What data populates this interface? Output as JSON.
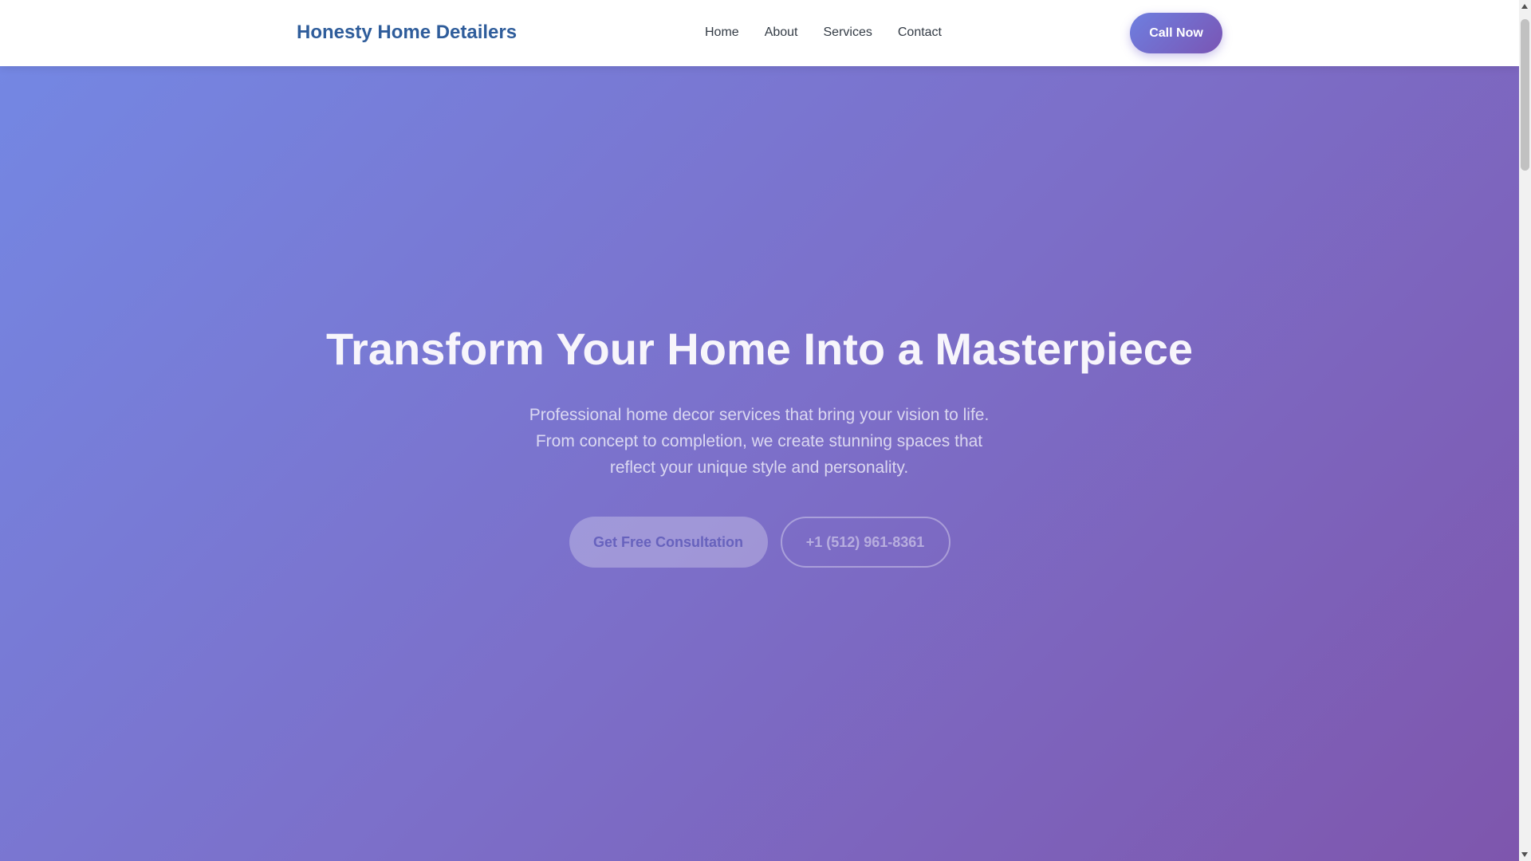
{
  "header": {
    "brand": "Honesty Home Detailers",
    "nav": [
      "Home",
      "About",
      "Services",
      "Contact"
    ],
    "call_button": "Call Now"
  },
  "hero": {
    "title": "Transform Your Home Into a Masterpiece",
    "subtitle": "Professional home decor services that bring your vision to life. From concept to completion, we create stunning spaces that reflect your unique style and personality.",
    "primary_button": "Get Free Consultation",
    "secondary_button": "+1 (512) 961-8361"
  },
  "colors": {
    "brand": "#2f5d9b",
    "gradient_start": "#7487e3",
    "gradient_end": "#7e56ad"
  },
  "icons": {
    "scroll_up": "scroll-up-arrow-icon",
    "scroll_down": "scroll-down-arrow-icon"
  }
}
